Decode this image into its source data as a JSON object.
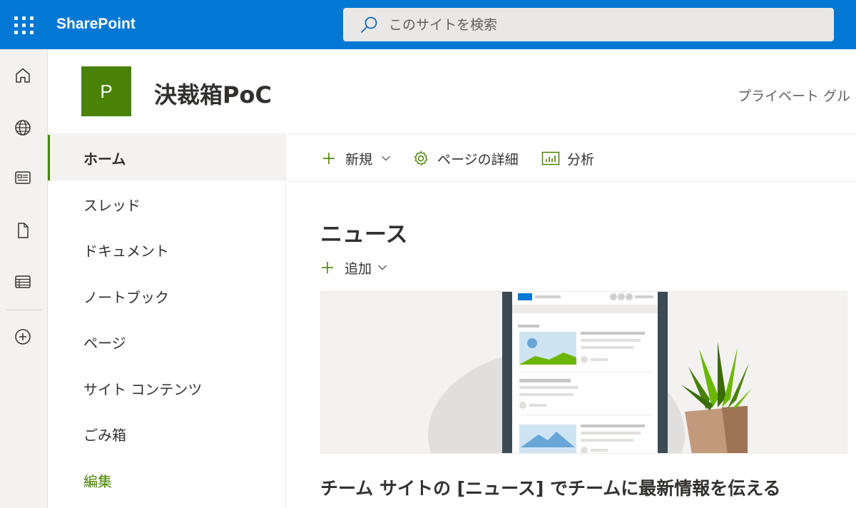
{
  "suite": {
    "brand": "SharePoint",
    "search_placeholder": "このサイトを検索"
  },
  "appbar": {
    "items": [
      {
        "icon": "home-icon"
      },
      {
        "icon": "globe-icon"
      },
      {
        "icon": "news-icon"
      },
      {
        "icon": "file-icon"
      },
      {
        "icon": "list-icon"
      },
      {
        "icon": "add-circle-icon"
      }
    ]
  },
  "site": {
    "logo_letter": "P",
    "title": "決裁箱PoC",
    "privacy": "プライベート グル"
  },
  "nav": {
    "items": [
      {
        "label": "ホーム",
        "active": true
      },
      {
        "label": "スレッド"
      },
      {
        "label": "ドキュメント"
      },
      {
        "label": "ノートブック"
      },
      {
        "label": "ページ"
      },
      {
        "label": "サイト コンテンツ"
      },
      {
        "label": "ごみ箱"
      },
      {
        "label": "編集"
      }
    ]
  },
  "commands": {
    "new_label": "新規",
    "page_details_label": "ページの詳細",
    "analytics_label": "分析"
  },
  "news": {
    "title": "ニュース",
    "add_label": "追加",
    "headline": "チーム サイトの [ニュース] でチームに最新情報を伝える"
  },
  "colors": {
    "suite_bar": "#0078d4",
    "site_accent": "#498205",
    "appbar_bg": "#f3f2f1"
  }
}
